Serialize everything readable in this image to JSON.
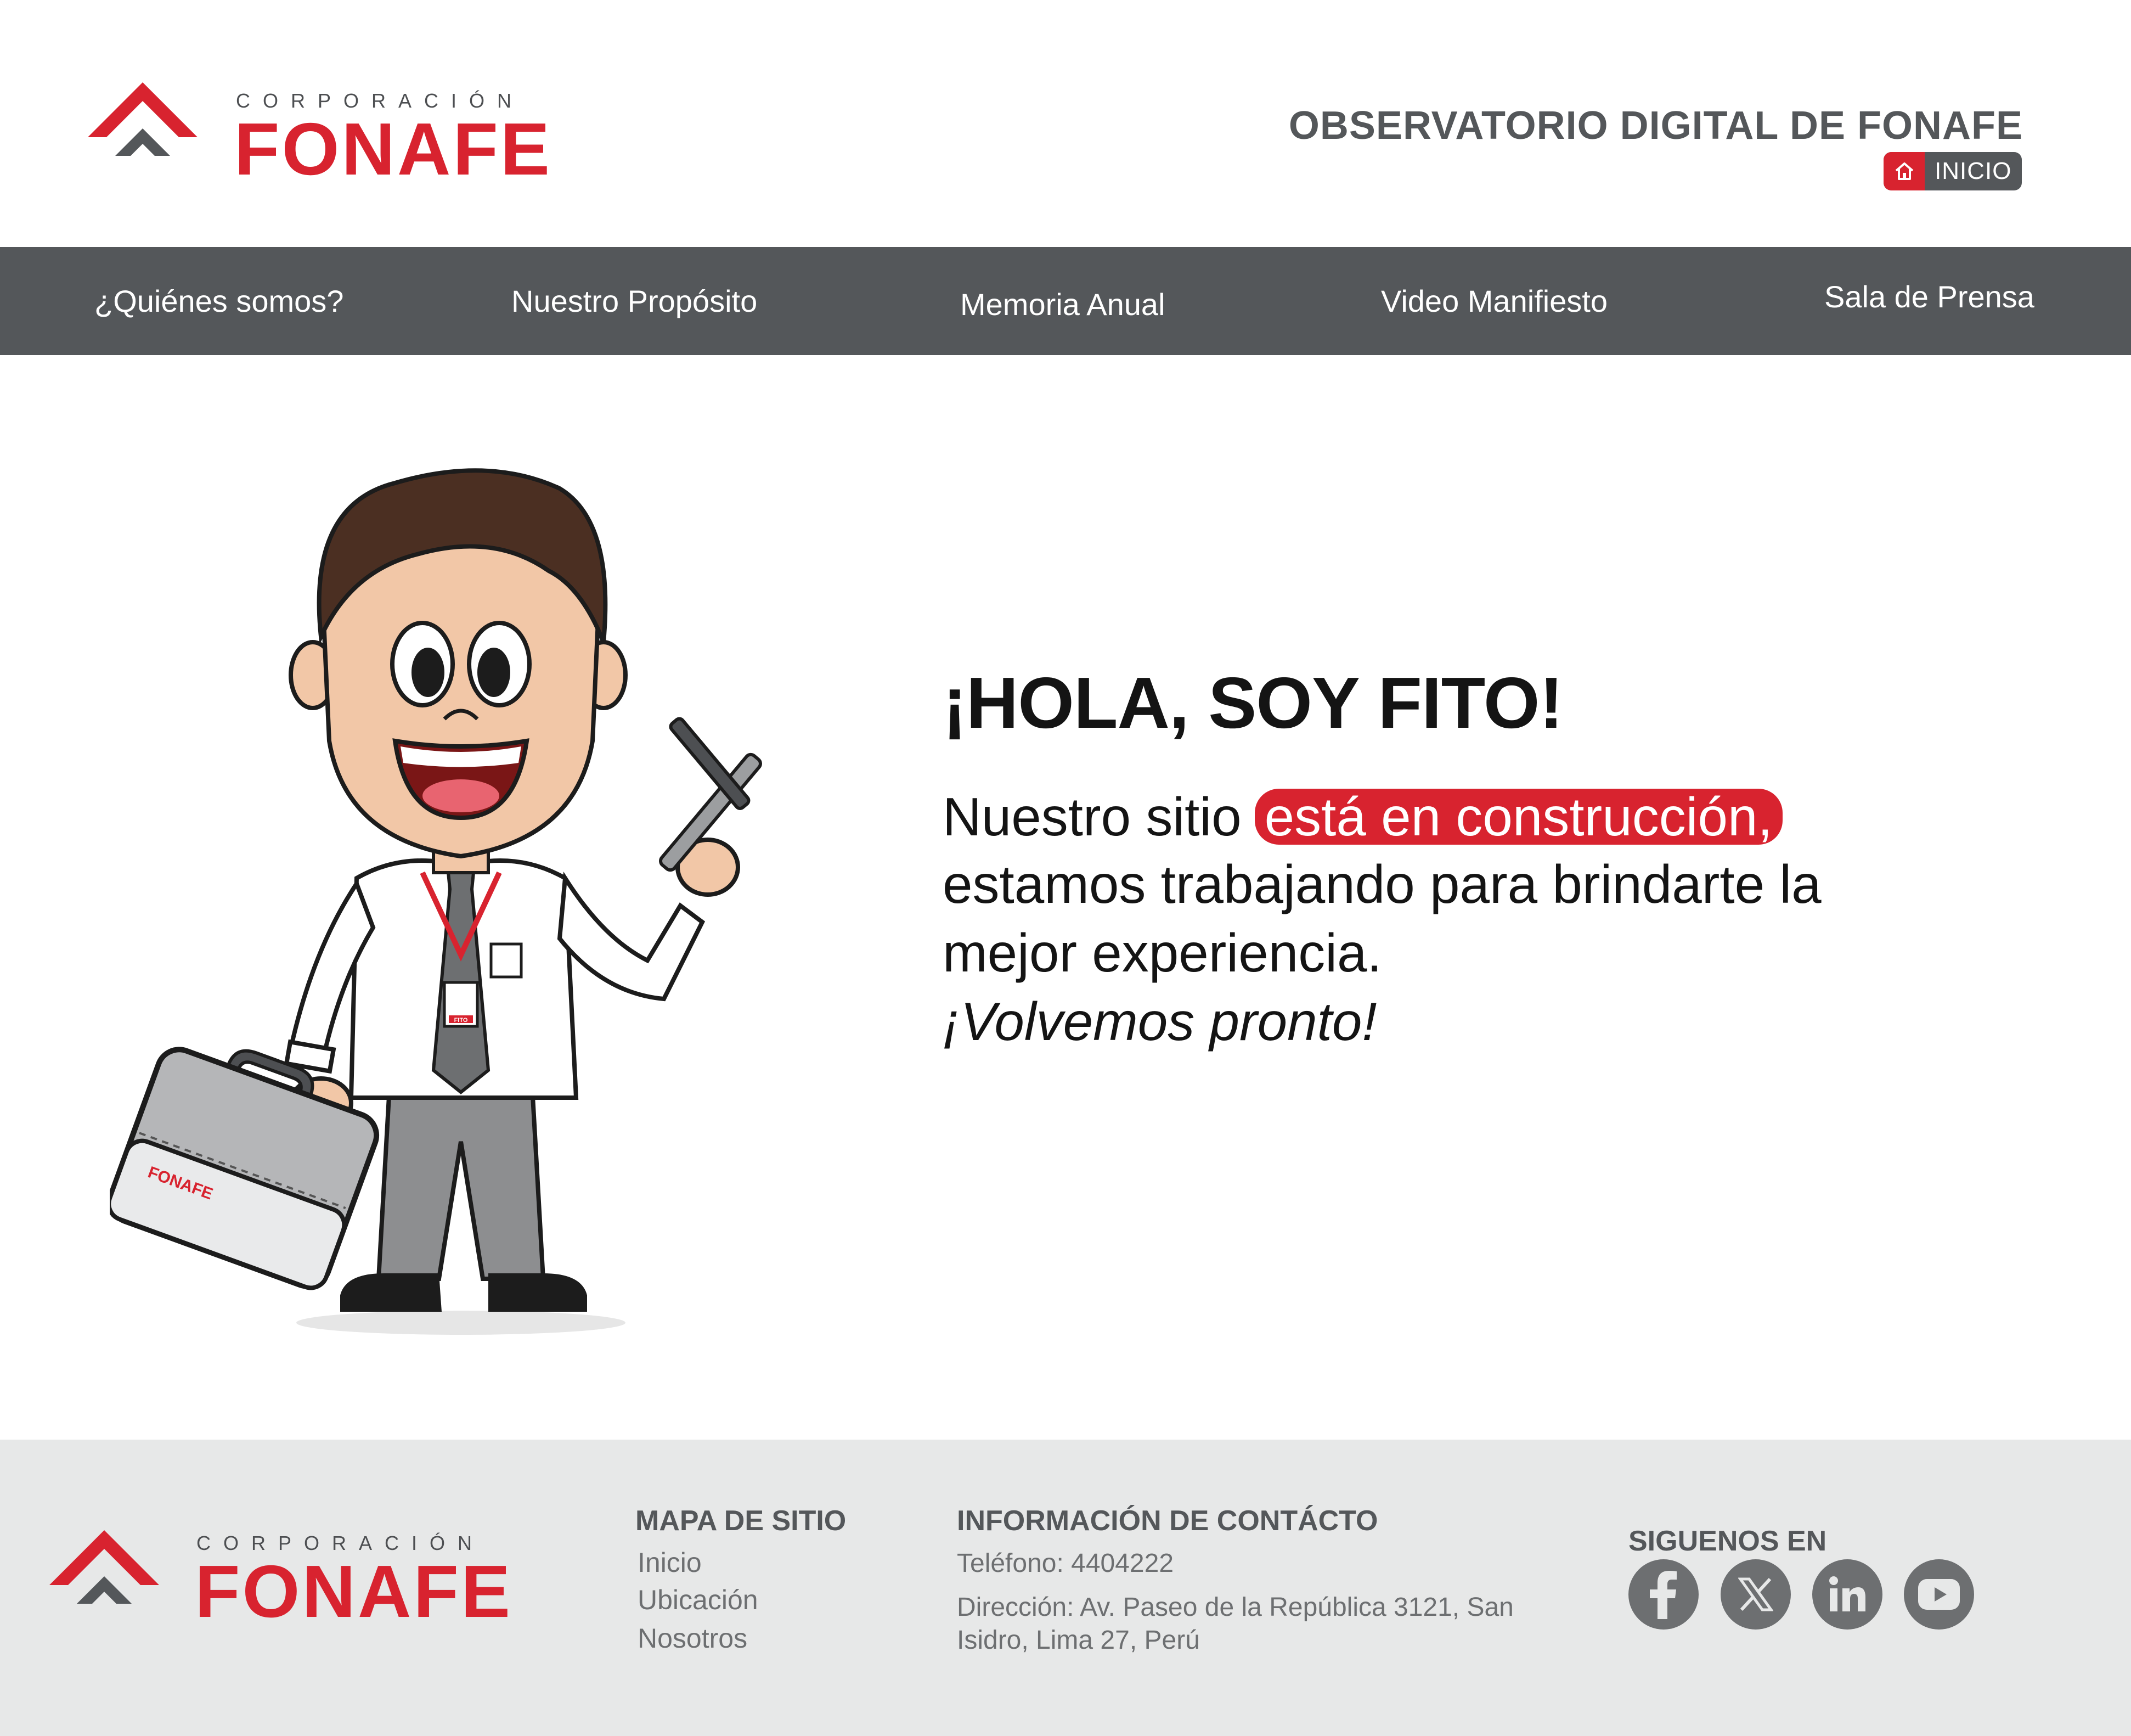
{
  "header": {
    "logo": {
      "top_text": "CORPORACIÓN",
      "main_text": "FONAFE"
    },
    "site_title": "OBSERVATORIO DIGITAL DE FONAFE",
    "home_button": {
      "label": "INICIO",
      "icon": "home-icon"
    }
  },
  "nav": {
    "items": [
      {
        "label": "¿Quiénes somos?"
      },
      {
        "label": "Nuestro Propósito"
      },
      {
        "label": "Memoria Anual"
      },
      {
        "label": "Video Manifiesto"
      },
      {
        "label": "Sala de Prensa"
      }
    ]
  },
  "main": {
    "title": "¡HOLA, SOY FITO!",
    "line1_prefix": "Nuestro  sitio",
    "line1_highlight": "está  en  construcción,",
    "line2": "estamos trabajando para brindarte la",
    "line3": "mejor experiencia.",
    "line4": "¡Volvemos pronto!",
    "mascot": {
      "name": "FITO",
      "badge_text": "FITO",
      "briefcase_logo": "FONAFE"
    }
  },
  "footer": {
    "logo": {
      "top_text": "CORPORACIÓN",
      "main_text": "FONAFE"
    },
    "sitemap": {
      "heading": "MAPA DE SITIO",
      "links": [
        {
          "label": "Inicio"
        },
        {
          "label": "Ubicación"
        },
        {
          "label": "Nosotros"
        }
      ]
    },
    "contact": {
      "heading": "INFORMACIÓN DE CONTÁCTO",
      "phone": "Teléfono: 4404222",
      "address_line1": "Dirección: Av. Paseo de la República 3121, San",
      "address_line2": "Isidro, Lima 27, Perú"
    },
    "social": {
      "heading": "SIGUENOS EN",
      "icons": [
        "facebook-icon",
        "x-icon",
        "linkedin-icon",
        "youtube-icon"
      ]
    }
  },
  "colors": {
    "brand_red": "#d8232f",
    "dark_gray": "#54575a",
    "footer_bg": "#e7e8e8"
  }
}
